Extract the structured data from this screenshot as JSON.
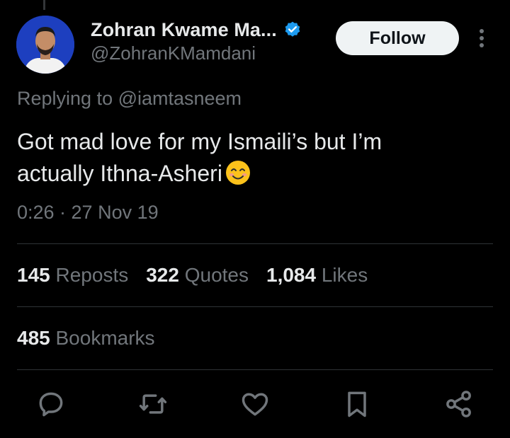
{
  "author": {
    "display_name": "Zohran Kwame Ma...",
    "handle": "@ZohranKMamdani",
    "verified": true
  },
  "follow_button": {
    "label": "Follow"
  },
  "reply_context": {
    "text": "Replying to @iamtasneem"
  },
  "tweet": {
    "text_line1": "Got mad love for my Ismaili’s but I’m",
    "text_line2": "actually Ithna-Asheri",
    "emoji": "smiling-face-with-smiling-eyes"
  },
  "meta": {
    "timestamp": "0:26 · 27 Nov 19"
  },
  "stats": {
    "reposts": {
      "count": "145",
      "label": "Reposts"
    },
    "quotes": {
      "count": "322",
      "label": "Quotes"
    },
    "likes": {
      "count": "1,084",
      "label": "Likes"
    },
    "bookmarks": {
      "count": "485",
      "label": "Bookmarks"
    }
  },
  "actions": [
    "reply-icon",
    "repost-icon",
    "like-icon",
    "bookmark-icon",
    "share-icon"
  ],
  "colors": {
    "background": "#000000",
    "primary_text": "#e7e9ea",
    "secondary_text": "#71767b",
    "verified_blue": "#1d9bf0",
    "divider": "#2f3336",
    "follow_button_bg": "#eff3f4"
  }
}
